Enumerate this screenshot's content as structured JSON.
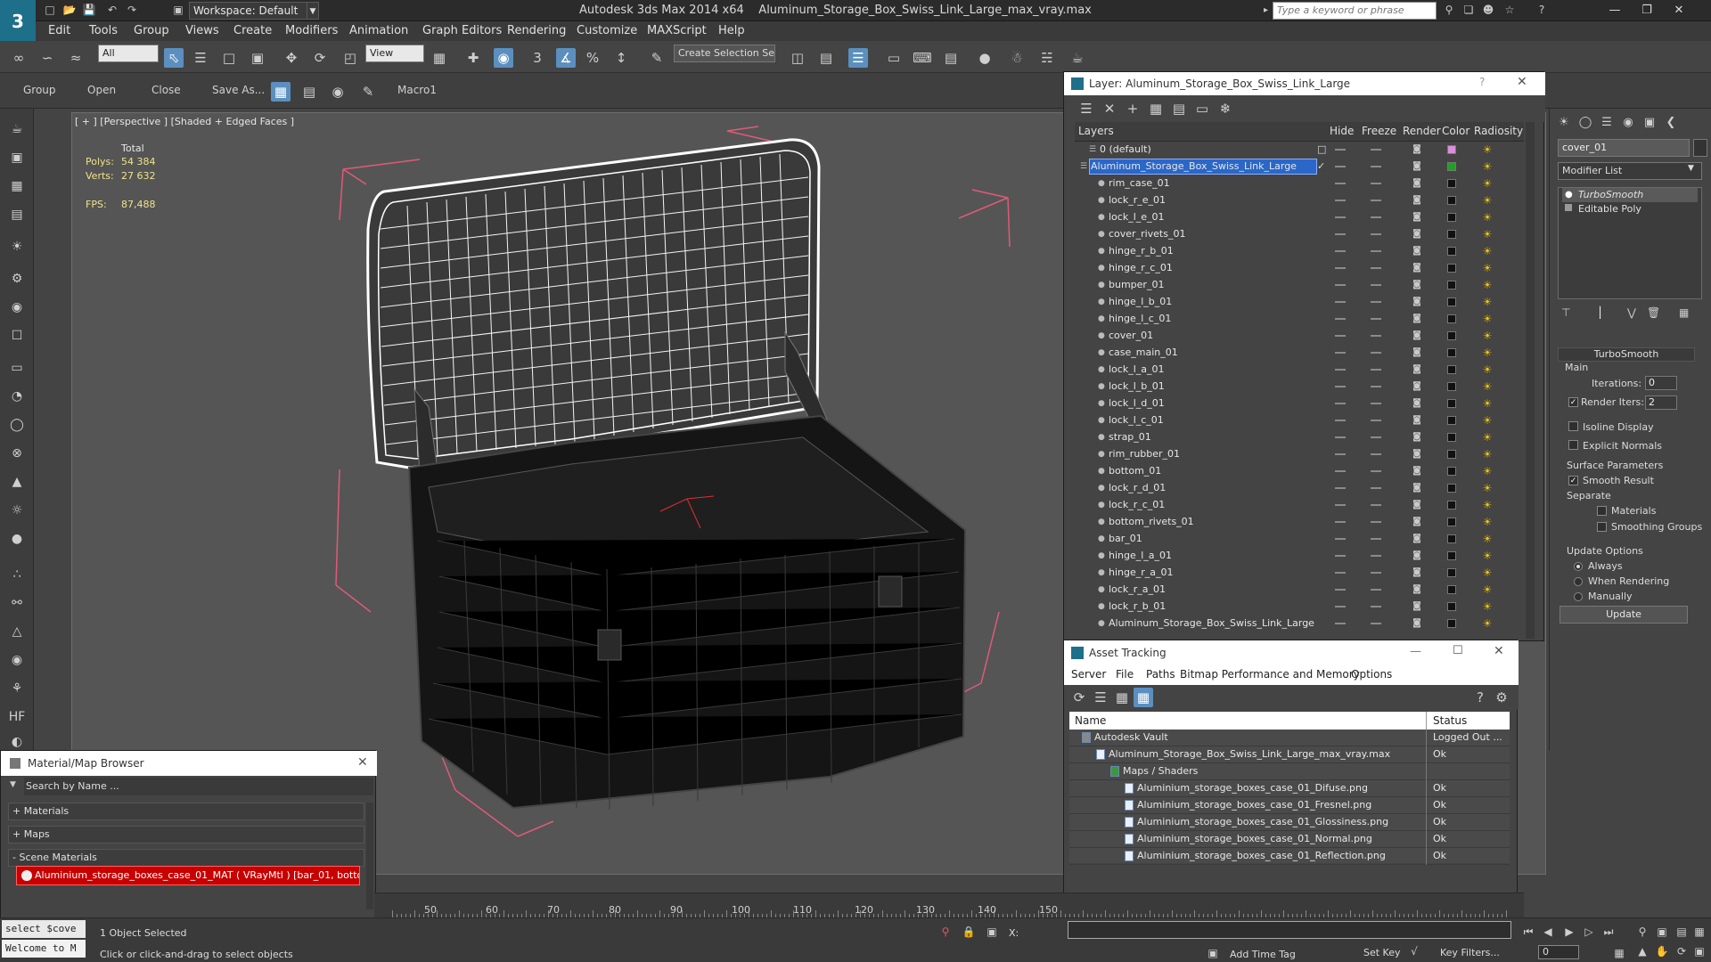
{
  "title_bar": {
    "app_title": "Autodesk 3ds Max  2014 x64",
    "file_name": "Aluminum_Storage_Box_Swiss_Link_Large_max_vray.max",
    "workspace_label": "Workspace: Default",
    "search_placeholder": "Type a keyword or phrase"
  },
  "menu": [
    "Edit",
    "Tools",
    "Group",
    "Views",
    "Create",
    "Modifiers",
    "Animation",
    "Graph Editors",
    "Rendering",
    "Customize",
    "MAXScript",
    "Help"
  ],
  "toolbar": {
    "selection_filter": "All",
    "ref_coord": "View",
    "named_selection": "Create Selection Se"
  },
  "ribbon": {
    "labels": [
      "Group",
      "Open",
      "Close",
      "Save As...",
      "Macro1"
    ]
  },
  "viewport": {
    "label": "[ + ] [Perspective ] [Shaded + Edged Faces ]",
    "stats_total": "Total",
    "polys_label": "Polys:",
    "polys_value": "54 384",
    "verts_label": "Verts:",
    "verts_value": "27 632",
    "fps_label": "FPS:",
    "fps_value": "87,488"
  },
  "layer_panel": {
    "title": "Layer: Aluminum_Storage_Box_Swiss_Link_Large",
    "headers": {
      "layers": "Layers",
      "hide": "Hide",
      "freeze": "Freeze",
      "render": "Render",
      "color": "Color",
      "radiosity": "Radiosity"
    },
    "rows": [
      {
        "name": "0 (default)",
        "indent": 1,
        "color": "#d98fd9"
      },
      {
        "name": "Aluminum_Storage_Box_Swiss_Link_Large",
        "indent": 0,
        "selected": true,
        "color": "#1fa21f"
      },
      {
        "name": "rim_case_01",
        "indent": 2,
        "color": "#111111"
      },
      {
        "name": "lock_r_e_01",
        "indent": 2,
        "color": "#111111"
      },
      {
        "name": "lock_l_e_01",
        "indent": 2,
        "color": "#111111"
      },
      {
        "name": "cover_rivets_01",
        "indent": 2,
        "color": "#111111"
      },
      {
        "name": "hinge_r_b_01",
        "indent": 2,
        "color": "#111111"
      },
      {
        "name": "hinge_r_c_01",
        "indent": 2,
        "color": "#111111"
      },
      {
        "name": "bumper_01",
        "indent": 2,
        "color": "#111111"
      },
      {
        "name": "hinge_l_b_01",
        "indent": 2,
        "color": "#111111"
      },
      {
        "name": "hinge_l_c_01",
        "indent": 2,
        "color": "#111111"
      },
      {
        "name": "cover_01",
        "indent": 2,
        "color": "#111111"
      },
      {
        "name": "case_main_01",
        "indent": 2,
        "color": "#111111"
      },
      {
        "name": "lock_l_a_01",
        "indent": 2,
        "color": "#111111"
      },
      {
        "name": "lock_l_b_01",
        "indent": 2,
        "color": "#111111"
      },
      {
        "name": "lock_l_d_01",
        "indent": 2,
        "color": "#111111"
      },
      {
        "name": "lock_l_c_01",
        "indent": 2,
        "color": "#111111"
      },
      {
        "name": "strap_01",
        "indent": 2,
        "color": "#111111"
      },
      {
        "name": "rim_rubber_01",
        "indent": 2,
        "color": "#111111"
      },
      {
        "name": "bottom_01",
        "indent": 2,
        "color": "#111111"
      },
      {
        "name": "lock_r_d_01",
        "indent": 2,
        "color": "#111111"
      },
      {
        "name": "lock_r_c_01",
        "indent": 2,
        "color": "#111111"
      },
      {
        "name": "bottom_rivets_01",
        "indent": 2,
        "color": "#111111"
      },
      {
        "name": "bar_01",
        "indent": 2,
        "color": "#111111"
      },
      {
        "name": "hinge_l_a_01",
        "indent": 2,
        "color": "#111111"
      },
      {
        "name": "hinge_r_a_01",
        "indent": 2,
        "color": "#111111"
      },
      {
        "name": "lock_r_a_01",
        "indent": 2,
        "color": "#111111"
      },
      {
        "name": "lock_r_b_01",
        "indent": 2,
        "color": "#111111"
      },
      {
        "name": "Aluminum_Storage_Box_Swiss_Link_Large",
        "indent": 2,
        "color": "#111111"
      }
    ]
  },
  "command_panel": {
    "object_name": "cover_01",
    "modifier_list": "Modifier List",
    "stack": [
      "TurboSmooth",
      "Editable Poly"
    ],
    "turbosmooth_title": "TurboSmooth",
    "main_label": "Main",
    "iterations_label": "Iterations:",
    "iterations_value": "0",
    "render_iters_label": "Render Iters:",
    "render_iters_value": "2",
    "isoline_label": "Isoline Display",
    "explicit_normals_label": "Explicit Normals",
    "surface_params_label": "Surface Parameters",
    "smooth_result_label": "Smooth Result",
    "separate_label": "Separate",
    "materials_label": "Materials",
    "smoothing_groups_label": "Smoothing Groups",
    "update_options_label": "Update Options",
    "always_label": "Always",
    "when_rendering_label": "When Rendering",
    "manually_label": "Manually",
    "update_button": "Update"
  },
  "asset_panel": {
    "title": "Asset Tracking",
    "menu": [
      "Server",
      "File",
      "Paths",
      "Bitmap Performance and Memory",
      "Options"
    ],
    "header_name": "Name",
    "header_status": "Status",
    "rows": [
      {
        "name": "Autodesk Vault",
        "status": "Logged Out ...",
        "indent": 1
      },
      {
        "name": "Aluminum_Storage_Box_Swiss_Link_Large_max_vray.max",
        "status": "Ok",
        "indent": 2
      },
      {
        "name": "Maps / Shaders",
        "status": "",
        "indent": 3
      },
      {
        "name": "Aluminium_storage_boxes_case_01_Difuse.png",
        "status": "Ok",
        "indent": 4
      },
      {
        "name": "Aluminium_storage_boxes_case_01_Fresnel.png",
        "status": "Ok",
        "indent": 4
      },
      {
        "name": "Aluminium_storage_boxes_case_01_Glossiness.png",
        "status": "Ok",
        "indent": 4
      },
      {
        "name": "Aluminium_storage_boxes_case_01_Normal.png",
        "status": "Ok",
        "indent": 4
      },
      {
        "name": "Aluminium_storage_boxes_case_01_Reflection.png",
        "status": "Ok",
        "indent": 4
      }
    ]
  },
  "material_browser": {
    "title": "Material/Map Browser",
    "search": "Search by Name ...",
    "groups": [
      "+ Materials",
      "+ Maps",
      "- Scene Materials"
    ],
    "entry": "Aluminium_storage_boxes_case_01_MAT ( VRayMtl ) [bar_01, botto..."
  },
  "timeline": {
    "ticks": [
      "50",
      "60",
      "70",
      "80",
      "90",
      "100",
      "110",
      "120",
      "130",
      "140",
      "150"
    ]
  },
  "status_bar": {
    "listener_top": "select $cove",
    "listener_bottom": "Welcome to M",
    "selection_info": "1 Object Selected",
    "prompt": "Click or click-and-drag to select objects",
    "add_time_tag": "Add Time Tag",
    "set_key": "Set Key",
    "key_filters": "Key Filters...",
    "x_label": "X:",
    "frame_value": "0"
  },
  "colors": {
    "accent": "#2a67c9",
    "viewport_bg": "#555555",
    "wire_white": "#ffffff",
    "bbox_pink": "#e05a78"
  }
}
